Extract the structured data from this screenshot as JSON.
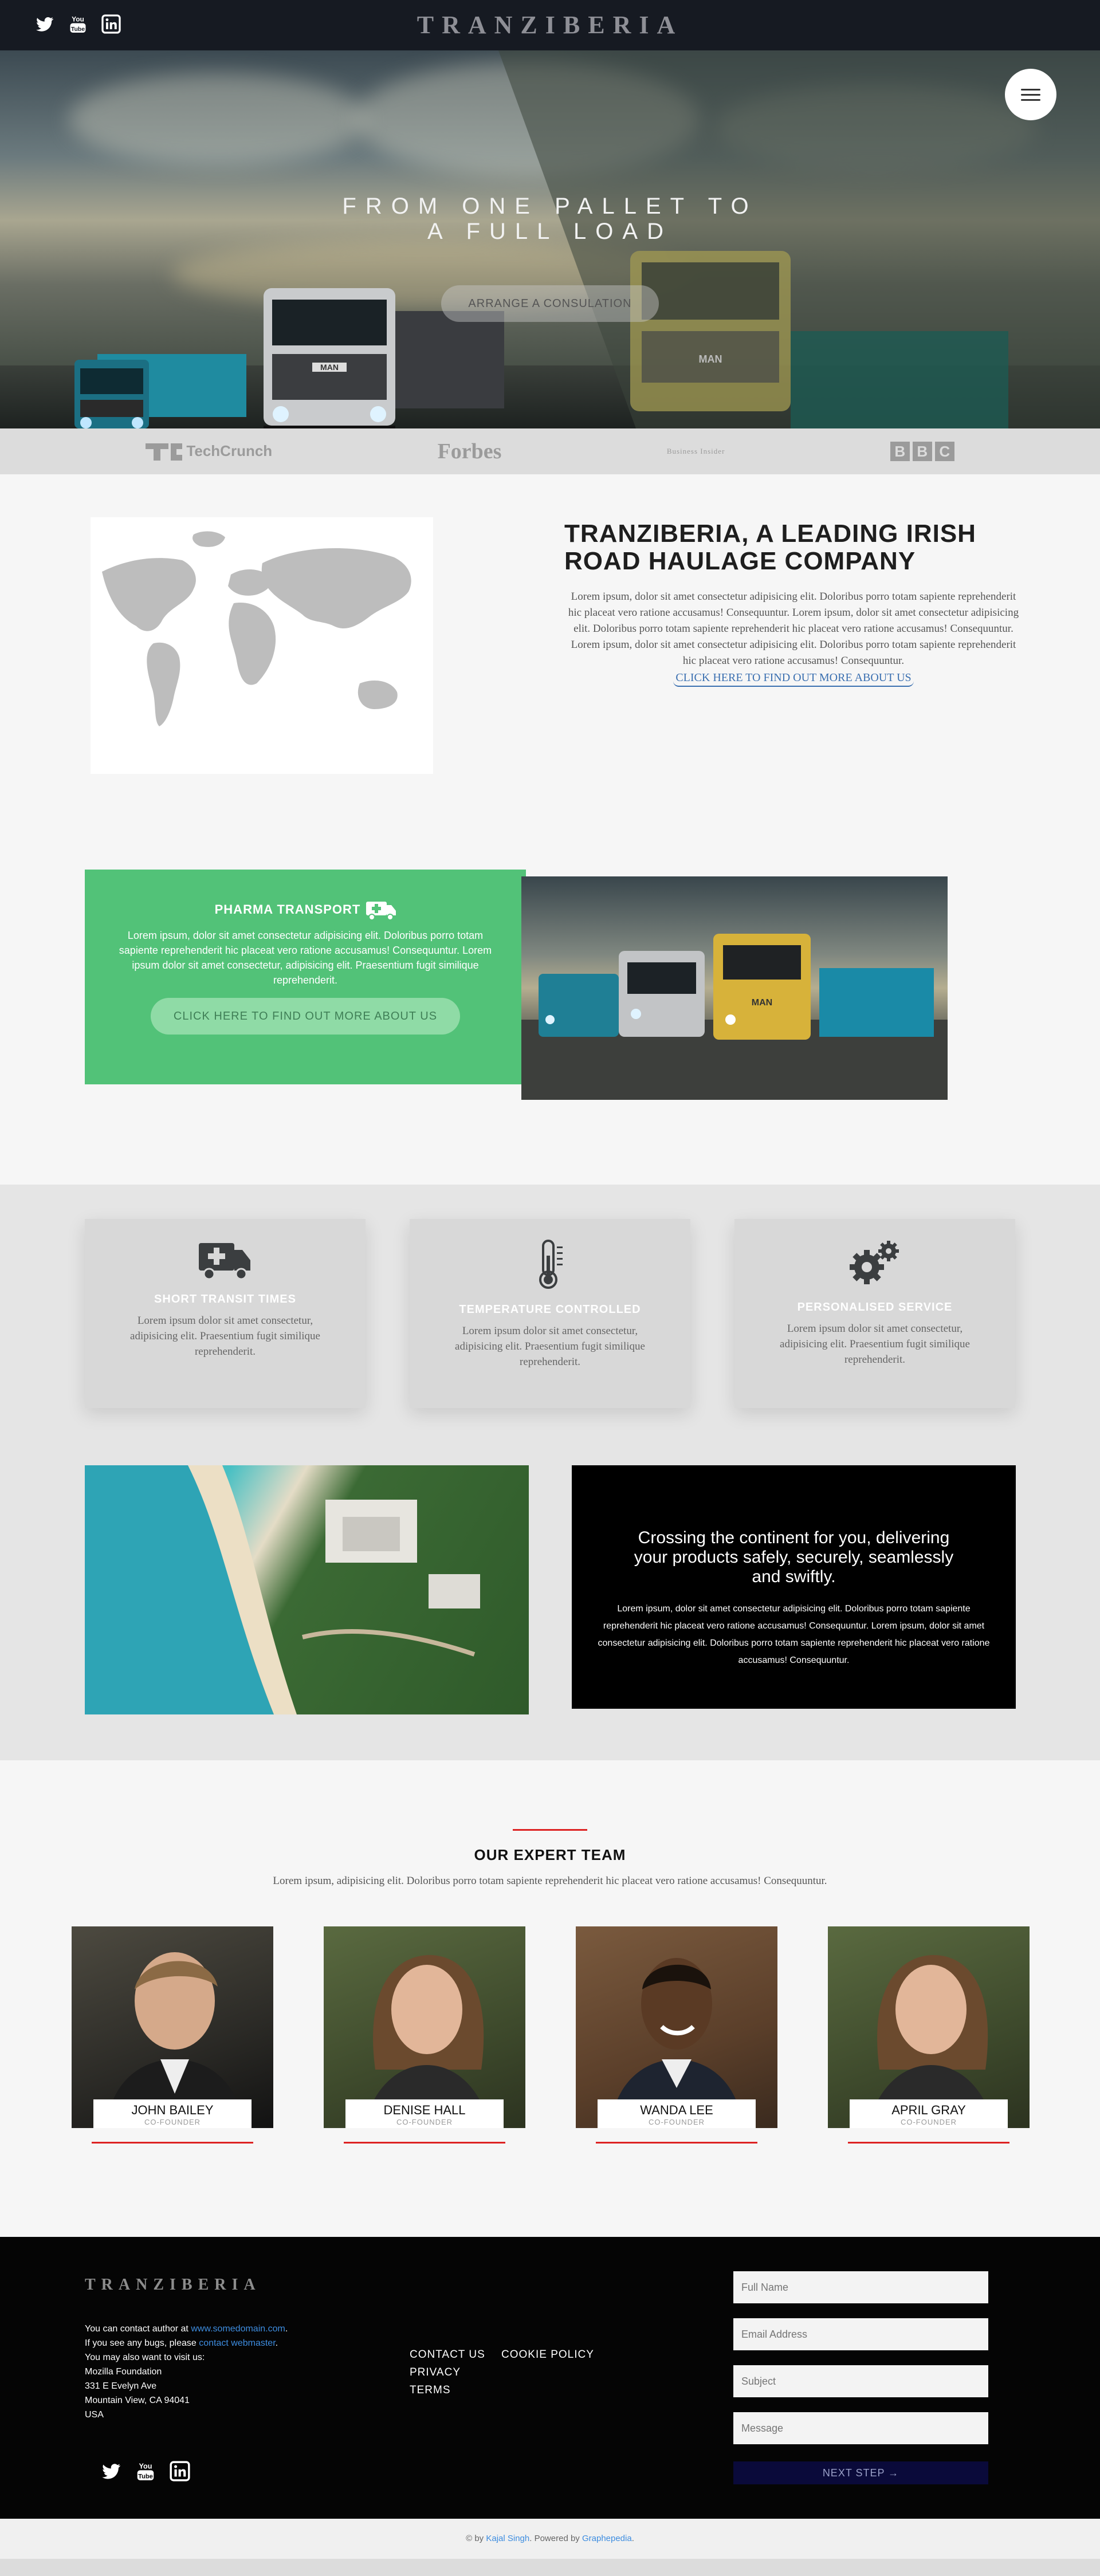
{
  "brand": "TRANZIBERIA",
  "header": {
    "social": [
      "twitter-icon",
      "youtube-icon",
      "linkedin-icon"
    ]
  },
  "hero": {
    "title_line1": "FROM ONE PALLET TO",
    "title_line2": "A FULL LOAD",
    "cta": "ARRANGE A CONSULATION",
    "menu_icon": "hamburger-icon"
  },
  "press_logos": [
    "TechCrunch",
    "Forbes",
    "Business Insider",
    "BBC"
  ],
  "about": {
    "heading": "TRANZIBERIA, A LEADING IRISH ROAD HAULAGE COMPANY",
    "body": "Lorem ipsum, dolor sit amet consectetur adipisicing elit. Doloribus porro totam sapiente reprehenderit hic placeat vero ratione accusamus! Consequuntur. Lorem ipsum, dolor sit amet consectetur adipisicing elit. Doloribus porro totam sapiente reprehenderit hic placeat vero ratione accusamus! Consequuntur. Lorem ipsum, dolor sit amet consectetur adipisicing elit. Doloribus porro totam sapiente reprehenderit hic placeat vero ratione accusamus! Consequuntur.",
    "link": "CLICK HERE TO FIND OUT MORE ABOUT US"
  },
  "pharma": {
    "title": "PHARMA TRANSPORT",
    "body": "Lorem ipsum, dolor sit amet consectetur adipisicing elit. Doloribus porro totam sapiente reprehenderit hic placeat vero ratione accusamus! Consequuntur. Lorem ipsum dolor sit amet consectetur, adipisicing elit. Praesentium fugit similique reprehenderit.",
    "cta": "CLICK HERE TO FIND OUT MORE ABOUT US",
    "accent": "#52c278"
  },
  "features": [
    {
      "icon": "ambulance-icon",
      "title": "SHORT TRANSIT TIMES",
      "body": "Lorem ipsum dolor sit amet consectetur, adipisicing elit. Praesentium fugit similique reprehenderit."
    },
    {
      "icon": "thermometer-icon",
      "title": "TEMPERATURE CONTROLLED",
      "body": "Lorem ipsum dolor sit amet consectetur, adipisicing elit. Praesentium fugit similique reprehenderit."
    },
    {
      "icon": "gears-icon",
      "title": "PERSONALISED SERVICE",
      "body": "Lorem ipsum dolor sit amet consectetur, adipisicing elit. Praesentium fugit similique reprehenderit."
    }
  ],
  "crossing": {
    "heading": "Crossing the continent for you, delivering your products safely, securely, seamlessly and swiftly.",
    "body": "Lorem ipsum, dolor sit amet consectetur adipisicing elit. Doloribus porro totam sapiente reprehenderit hic placeat vero ratione accusamus! Consequuntur. Lorem ipsum, dolor sit amet consectetur adipisicing elit. Doloribus porro totam sapiente reprehenderit hic placeat vero ratione accusamus! Consequuntur."
  },
  "team": {
    "heading": "OUR EXPERT TEAM",
    "sub": "Lorem ipsum, adipisicing elit. Doloribus porro totam sapiente reprehenderit hic placeat vero ratione accusamus! Consequuntur.",
    "members": [
      {
        "name": "JOHN BAILEY",
        "role": "CO-FOUNDER"
      },
      {
        "name": "DENISE HALL",
        "role": "CO-FOUNDER"
      },
      {
        "name": "WANDA LEE",
        "role": "CO-FOUNDER"
      },
      {
        "name": "APRIL GRAY",
        "role": "CO-FOUNDER"
      }
    ]
  },
  "footer": {
    "brand": "TRANZIBERIA",
    "contact_prefix": "You can contact author at ",
    "contact_link": "www.somedomain.com",
    "bugs_prefix": "If you see any bugs, please ",
    "bugs_link": "contact webmaster",
    "visit": "You may also want to visit us:",
    "org": "Mozilla Foundation",
    "street": "331 E Evelyn Ave",
    "city": "Mountain View, CA 94041",
    "country": "USA",
    "links": [
      "CONTACT US",
      "COOKIE POLICY",
      "PRIVACY",
      "TERMS"
    ],
    "form": {
      "name_ph": "Full Name",
      "email_ph": "Email Address",
      "subject_ph": "Subject",
      "message_ph": "Message",
      "submit": "NEXT STEP →"
    }
  },
  "copyright": {
    "prefix": "© by ",
    "author": "Kajal Singh",
    "middle": ". Powered by ",
    "powered": "Graphepedia",
    "suffix": "."
  }
}
